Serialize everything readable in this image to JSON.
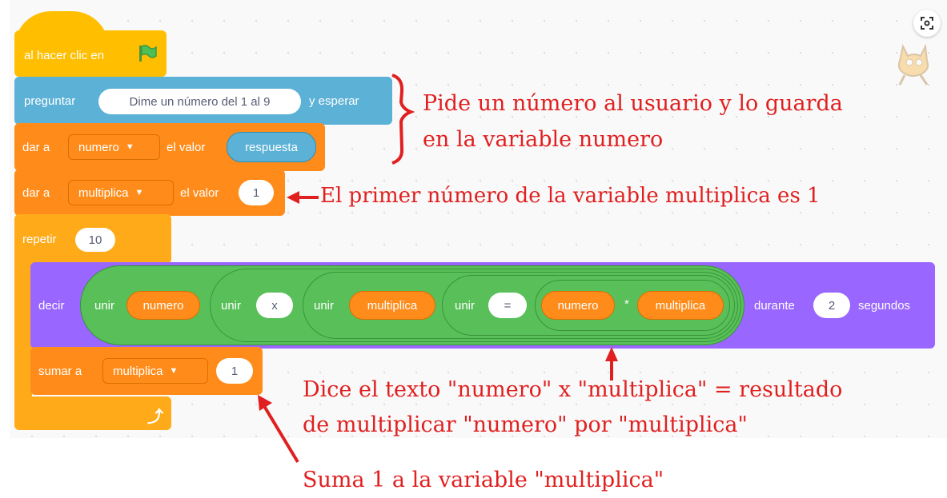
{
  "blocks": {
    "hat": {
      "text": "al hacer clic en",
      "flag_icon": "green-flag-icon"
    },
    "ask": {
      "text": "preguntar",
      "question": "Dime un número del 1 al 9",
      "suffix": "y esperar"
    },
    "set_numero": {
      "text": "dar a",
      "variable": "numero",
      "value_label": "el valor",
      "reporter": "respuesta"
    },
    "set_multiplica": {
      "text": "dar a",
      "variable": "multiplica",
      "value_label": "el valor",
      "value": "1"
    },
    "repeat": {
      "text": "repetir",
      "times": "10",
      "loop_icon": "loop-arrow-icon"
    },
    "say": {
      "text": "decir",
      "join": "unir",
      "numero": "numero",
      "x": "x",
      "multiplica": "multiplica",
      "equals": "=",
      "times_op": "*",
      "during": "durante",
      "seconds_value": "2",
      "seconds": "segundos"
    },
    "change": {
      "text": "sumar a",
      "variable": "multiplica",
      "value": "1"
    }
  },
  "annotations": {
    "ask_line1": "Pide un número al usuario y lo guarda",
    "ask_line2": "en la variable numero",
    "first_value": "El primer número de la variable multiplica es 1",
    "say_line1": "Dice el texto \"numero\" x \"multiplica\" = resultado",
    "say_line2": "de multiplicar \"numero\" por \"multiplica\"",
    "change": "Suma 1 a la variable \"multiplica\""
  },
  "colors": {
    "events": "#ffbf00",
    "sensing": "#5cb1d6",
    "variables": "#ff8c1a",
    "control": "#ffab19",
    "looks": "#9966ff",
    "operators": "#59c059",
    "annotation": "#e02020"
  },
  "icons": {
    "zoom": "focus-icon",
    "mascot": "scratch-cat-icon"
  }
}
